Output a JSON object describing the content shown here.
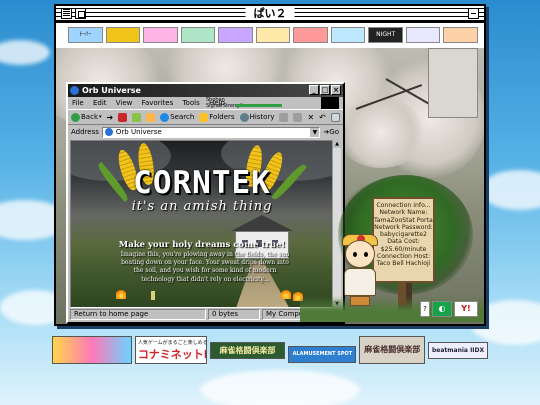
{
  "outer_window": {
    "title": "ぱい２"
  },
  "top_banners": [
    {
      "label": "ﾄｰﾊｰ",
      "color": "#9fd4ff"
    },
    {
      "label": "",
      "color": "#f0c419"
    },
    {
      "label": "",
      "color": "#ffb3e6"
    },
    {
      "label": "",
      "color": "#aee6c7"
    },
    {
      "label": "",
      "color": "#c9a6ff"
    },
    {
      "label": "",
      "color": "#ffe9a8"
    },
    {
      "label": "",
      "color": "#ff9a9a"
    },
    {
      "label": "",
      "color": "#bde8ff"
    },
    {
      "label": "NIGHT",
      "color": "#222222"
    },
    {
      "label": "",
      "color": "#e8e8ff"
    },
    {
      "label": "",
      "color": "#ffd1a8"
    }
  ],
  "browser": {
    "title": "Orb Universe",
    "menu": [
      "File",
      "Edit",
      "View",
      "Favorites",
      "Tools",
      "Help"
    ],
    "signal": {
      "line1": "Shohan",
      "line2": "Signal Strength:"
    },
    "toolbar": {
      "back": "Back",
      "search": "Search",
      "folders": "Folders",
      "history": "History"
    },
    "address_label": "Address",
    "address_value": "Orb Universe",
    "go_label": "Go",
    "status_left": "Return to home page",
    "status_mid": "0 bytes",
    "status_right": "My Computer"
  },
  "page": {
    "logo": "CORNTEK",
    "tagline": "it's an amish thing",
    "headline": "Make your holy dreams come true!",
    "body": "Imagine this, you're plowing away in the fields, the sun beating down on your face. Your sweat drips down into the soil, and you wish for some kind of modern technology that didn't rely on electricity..."
  },
  "info_sign": {
    "lines": [
      "Connection info...",
      "Network Name:",
      "TamaZooStat Portal",
      "Network Password:",
      "babycigarette2",
      "Data Cost:",
      "$25.60/minute",
      "Connection Host:",
      "Taco Bell Hachioji"
    ]
  },
  "corner_icons": {
    "question": "?",
    "yahoo": "Y!"
  },
  "bottom_banners": {
    "b1": "",
    "b2_small": "人気ゲームがまるごと楽しめる！",
    "b2_big": "コナミネットDX",
    "b3": "麻雀格闘倶楽部",
    "b4": "ALAMUSEMENT SPOT",
    "b5": "麻雀格闘倶楽部",
    "b6": "beatmania IIDX"
  }
}
